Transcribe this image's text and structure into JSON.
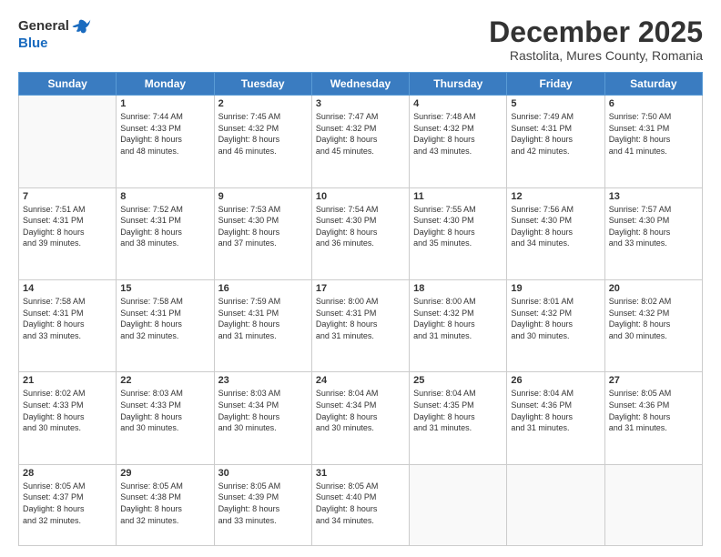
{
  "logo": {
    "general": "General",
    "blue": "Blue"
  },
  "header": {
    "month_title": "December 2025",
    "subtitle": "Rastolita, Mures County, Romania"
  },
  "days_of_week": [
    "Sunday",
    "Monday",
    "Tuesday",
    "Wednesday",
    "Thursday",
    "Friday",
    "Saturday"
  ],
  "weeks": [
    [
      {
        "day": "",
        "info": ""
      },
      {
        "day": "1",
        "info": "Sunrise: 7:44 AM\nSunset: 4:33 PM\nDaylight: 8 hours\nand 48 minutes."
      },
      {
        "day": "2",
        "info": "Sunrise: 7:45 AM\nSunset: 4:32 PM\nDaylight: 8 hours\nand 46 minutes."
      },
      {
        "day": "3",
        "info": "Sunrise: 7:47 AM\nSunset: 4:32 PM\nDaylight: 8 hours\nand 45 minutes."
      },
      {
        "day": "4",
        "info": "Sunrise: 7:48 AM\nSunset: 4:32 PM\nDaylight: 8 hours\nand 43 minutes."
      },
      {
        "day": "5",
        "info": "Sunrise: 7:49 AM\nSunset: 4:31 PM\nDaylight: 8 hours\nand 42 minutes."
      },
      {
        "day": "6",
        "info": "Sunrise: 7:50 AM\nSunset: 4:31 PM\nDaylight: 8 hours\nand 41 minutes."
      }
    ],
    [
      {
        "day": "7",
        "info": "Sunrise: 7:51 AM\nSunset: 4:31 PM\nDaylight: 8 hours\nand 39 minutes."
      },
      {
        "day": "8",
        "info": "Sunrise: 7:52 AM\nSunset: 4:31 PM\nDaylight: 8 hours\nand 38 minutes."
      },
      {
        "day": "9",
        "info": "Sunrise: 7:53 AM\nSunset: 4:30 PM\nDaylight: 8 hours\nand 37 minutes."
      },
      {
        "day": "10",
        "info": "Sunrise: 7:54 AM\nSunset: 4:30 PM\nDaylight: 8 hours\nand 36 minutes."
      },
      {
        "day": "11",
        "info": "Sunrise: 7:55 AM\nSunset: 4:30 PM\nDaylight: 8 hours\nand 35 minutes."
      },
      {
        "day": "12",
        "info": "Sunrise: 7:56 AM\nSunset: 4:30 PM\nDaylight: 8 hours\nand 34 minutes."
      },
      {
        "day": "13",
        "info": "Sunrise: 7:57 AM\nSunset: 4:30 PM\nDaylight: 8 hours\nand 33 minutes."
      }
    ],
    [
      {
        "day": "14",
        "info": "Sunrise: 7:58 AM\nSunset: 4:31 PM\nDaylight: 8 hours\nand 33 minutes."
      },
      {
        "day": "15",
        "info": "Sunrise: 7:58 AM\nSunset: 4:31 PM\nDaylight: 8 hours\nand 32 minutes."
      },
      {
        "day": "16",
        "info": "Sunrise: 7:59 AM\nSunset: 4:31 PM\nDaylight: 8 hours\nand 31 minutes."
      },
      {
        "day": "17",
        "info": "Sunrise: 8:00 AM\nSunset: 4:31 PM\nDaylight: 8 hours\nand 31 minutes."
      },
      {
        "day": "18",
        "info": "Sunrise: 8:00 AM\nSunset: 4:32 PM\nDaylight: 8 hours\nand 31 minutes."
      },
      {
        "day": "19",
        "info": "Sunrise: 8:01 AM\nSunset: 4:32 PM\nDaylight: 8 hours\nand 30 minutes."
      },
      {
        "day": "20",
        "info": "Sunrise: 8:02 AM\nSunset: 4:32 PM\nDaylight: 8 hours\nand 30 minutes."
      }
    ],
    [
      {
        "day": "21",
        "info": "Sunrise: 8:02 AM\nSunset: 4:33 PM\nDaylight: 8 hours\nand 30 minutes."
      },
      {
        "day": "22",
        "info": "Sunrise: 8:03 AM\nSunset: 4:33 PM\nDaylight: 8 hours\nand 30 minutes."
      },
      {
        "day": "23",
        "info": "Sunrise: 8:03 AM\nSunset: 4:34 PM\nDaylight: 8 hours\nand 30 minutes."
      },
      {
        "day": "24",
        "info": "Sunrise: 8:04 AM\nSunset: 4:34 PM\nDaylight: 8 hours\nand 30 minutes."
      },
      {
        "day": "25",
        "info": "Sunrise: 8:04 AM\nSunset: 4:35 PM\nDaylight: 8 hours\nand 31 minutes."
      },
      {
        "day": "26",
        "info": "Sunrise: 8:04 AM\nSunset: 4:36 PM\nDaylight: 8 hours\nand 31 minutes."
      },
      {
        "day": "27",
        "info": "Sunrise: 8:05 AM\nSunset: 4:36 PM\nDaylight: 8 hours\nand 31 minutes."
      }
    ],
    [
      {
        "day": "28",
        "info": "Sunrise: 8:05 AM\nSunset: 4:37 PM\nDaylight: 8 hours\nand 32 minutes."
      },
      {
        "day": "29",
        "info": "Sunrise: 8:05 AM\nSunset: 4:38 PM\nDaylight: 8 hours\nand 32 minutes."
      },
      {
        "day": "30",
        "info": "Sunrise: 8:05 AM\nSunset: 4:39 PM\nDaylight: 8 hours\nand 33 minutes."
      },
      {
        "day": "31",
        "info": "Sunrise: 8:05 AM\nSunset: 4:40 PM\nDaylight: 8 hours\nand 34 minutes."
      },
      {
        "day": "",
        "info": ""
      },
      {
        "day": "",
        "info": ""
      },
      {
        "day": "",
        "info": ""
      }
    ]
  ]
}
